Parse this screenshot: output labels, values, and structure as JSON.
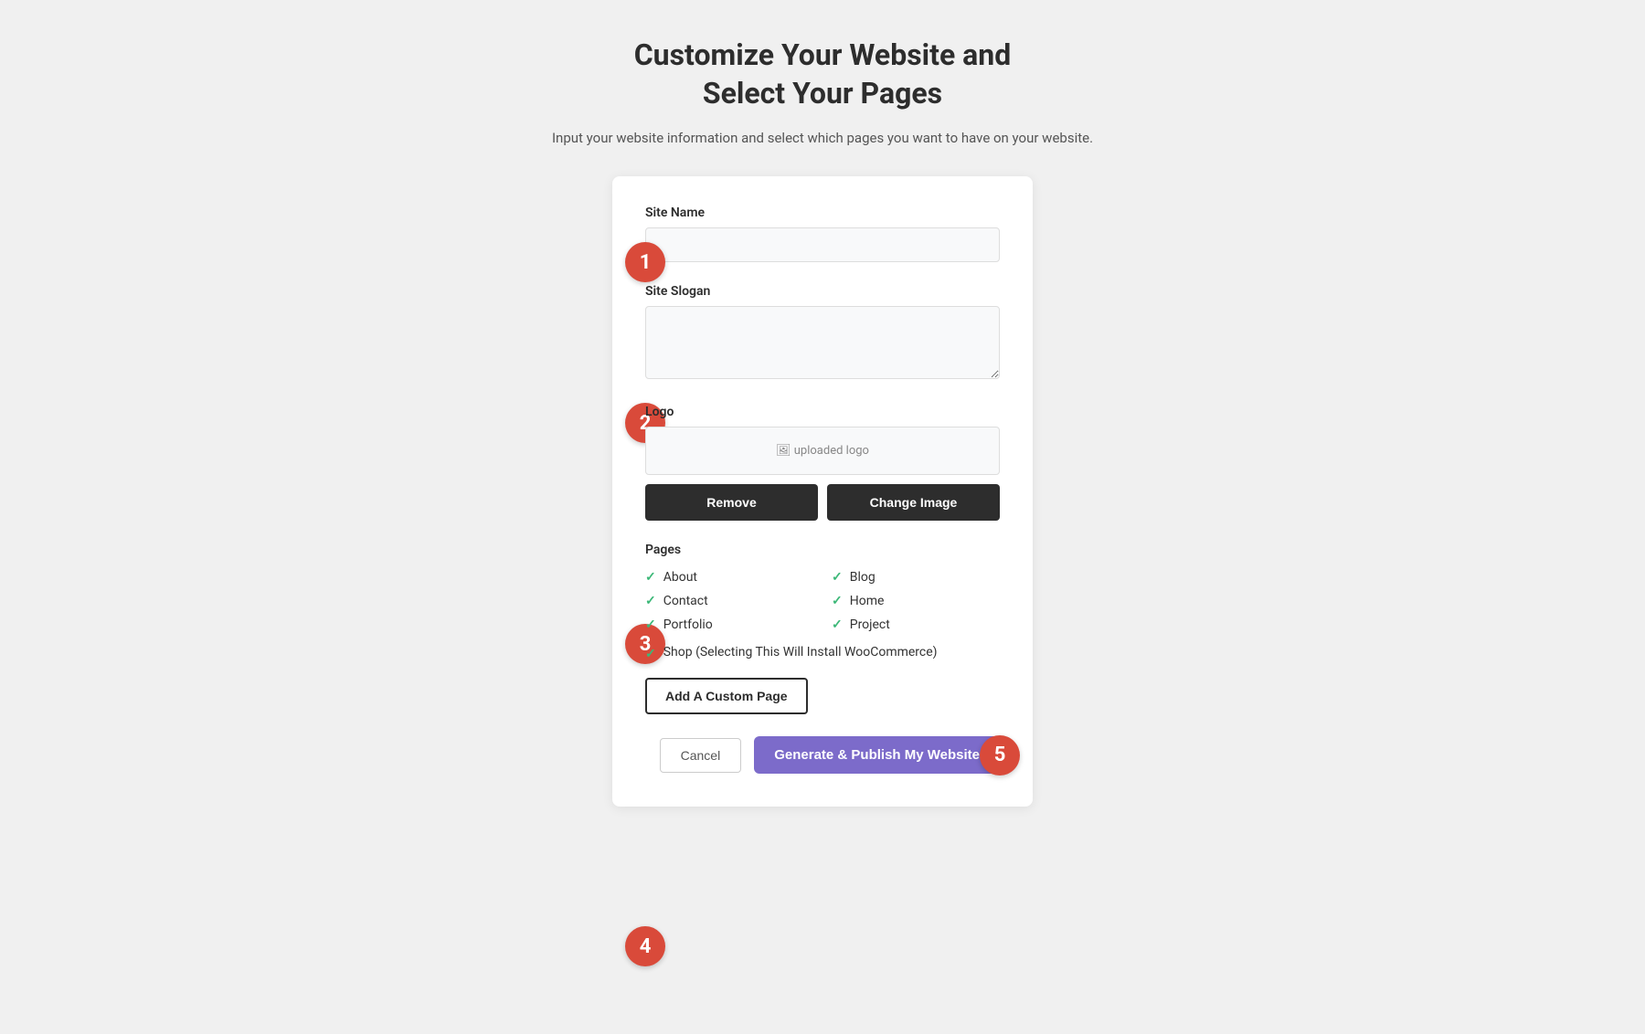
{
  "header": {
    "title_line1": "Customize Your Website and",
    "title_line2": "Select Your Pages",
    "subtitle": "Input your website information and select which pages you want to have on your website."
  },
  "form": {
    "site_name_label": "Site Name",
    "site_name_placeholder": "",
    "site_slogan_label": "Site Slogan",
    "site_slogan_placeholder": "",
    "logo_label": "Logo",
    "logo_preview_text": "uploaded logo",
    "remove_button": "Remove",
    "change_image_button": "Change Image",
    "pages_label": "Pages",
    "pages": [
      {
        "name": "About",
        "checked": true
      },
      {
        "name": "Blog",
        "checked": true
      },
      {
        "name": "Contact",
        "checked": true
      },
      {
        "name": "Home",
        "checked": true
      },
      {
        "name": "Portfolio",
        "checked": true
      },
      {
        "name": "Project",
        "checked": true
      }
    ],
    "shop_page": {
      "label": "Shop (Selecting This Will Install WooCommerce)",
      "checked": true
    },
    "add_custom_page_button": "Add A Custom Page",
    "cancel_button": "Cancel",
    "publish_button": "Generate & Publish My Website"
  },
  "steps": {
    "step1": "1",
    "step2": "2",
    "step3": "3",
    "step4": "4",
    "step5": "5"
  }
}
